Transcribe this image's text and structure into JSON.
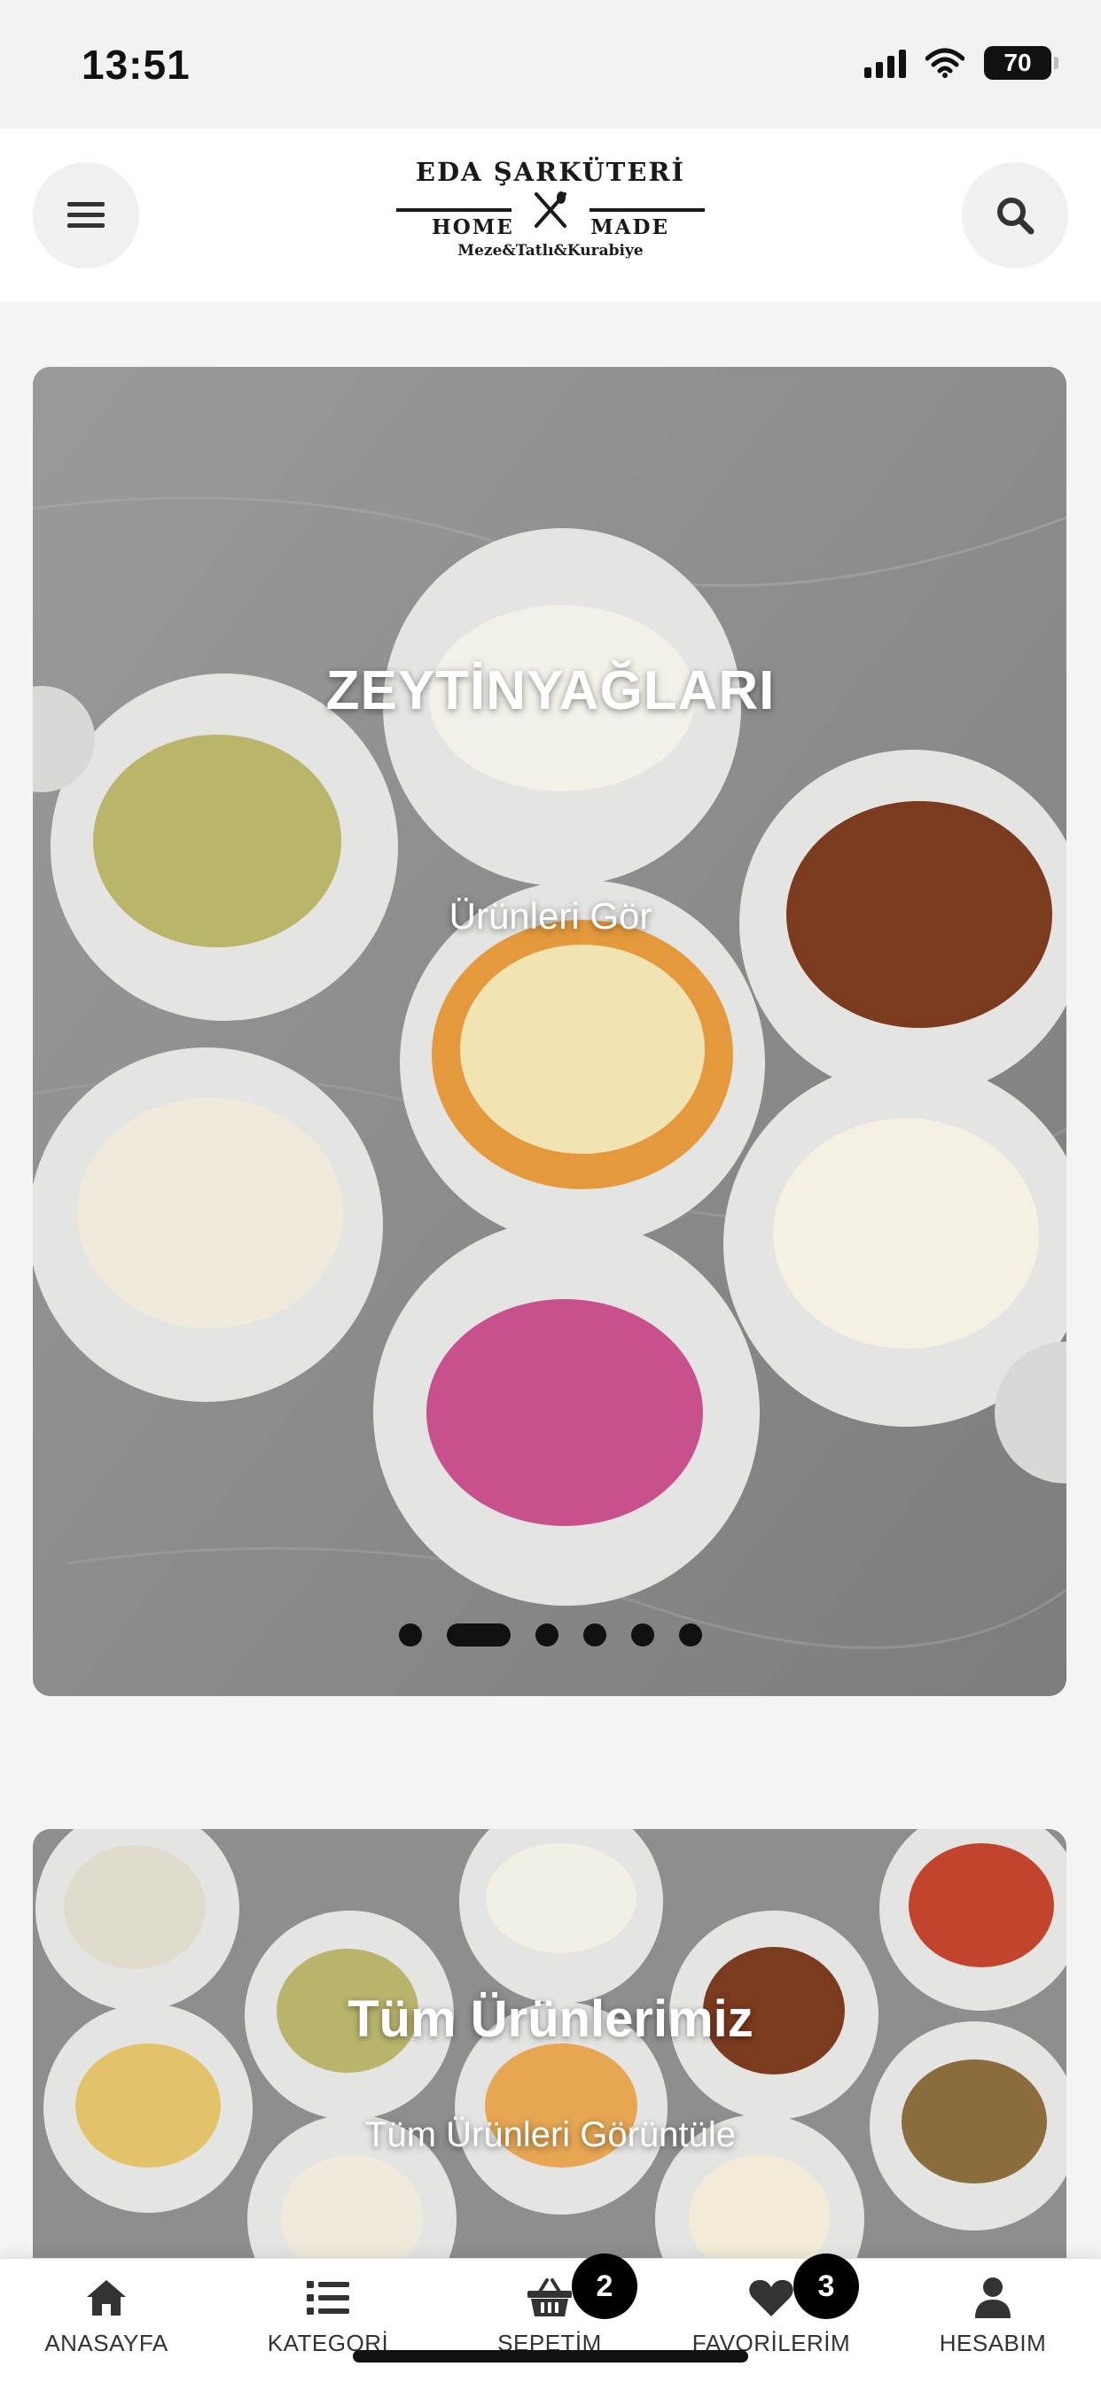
{
  "status_bar": {
    "time": "13:51",
    "battery": "70"
  },
  "header": {
    "logo": {
      "brand": "EDA ŞARKÜTERİ",
      "left_word": "HOME",
      "right_word": "MADE",
      "tagline": "Meze&Tatlı&Kurabiye"
    },
    "menu_icon": "hamburger-menu-icon",
    "search_icon": "search-icon"
  },
  "hero_banner": {
    "title": "ZEYTİNYAĞLARI",
    "link": "Ürünleri Gör",
    "slides": 6,
    "active_slide": 2
  },
  "all_products_banner": {
    "title": "Tüm Ürünlerimiz",
    "link": "Tüm Ürünleri Görüntüle"
  },
  "tab_bar": {
    "items": [
      {
        "label": "ANASAYFA",
        "icon": "home-icon"
      },
      {
        "label": "KATEGORİ",
        "icon": "list-icon"
      },
      {
        "label": "SEPETİM",
        "icon": "basket-icon",
        "badge": "2"
      },
      {
        "label": "FAVORİLERİM",
        "icon": "heart-icon",
        "badge": "3"
      },
      {
        "label": "HESABIM",
        "icon": "user-icon"
      }
    ]
  },
  "colors": {
    "accent": "#000000",
    "header_bg": "#ffffff",
    "page_bg": "#f3f4f3"
  }
}
